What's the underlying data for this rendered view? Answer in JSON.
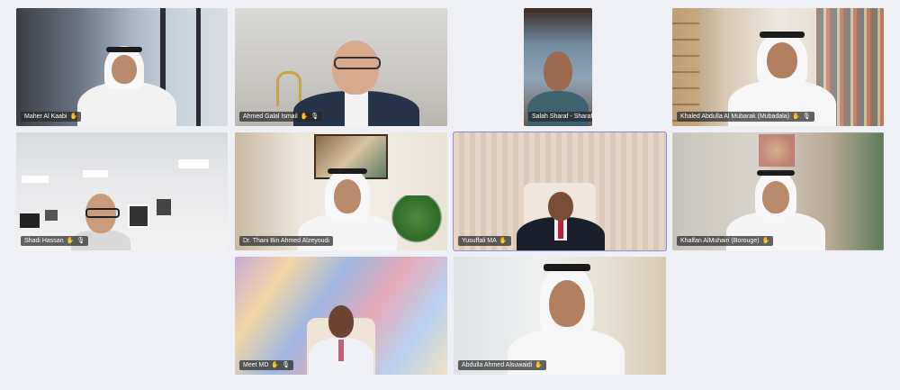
{
  "participants": [
    {
      "name": "Maher Al Kaabi",
      "mic": "muted"
    },
    {
      "name": "Ahmed Galal Ismail",
      "mic": "muted"
    },
    {
      "name": "Salah Sharaf - Sharaf Group",
      "mic": "muted"
    },
    {
      "name": "Khaled Abdulla Al Mubarak (Mubadala)",
      "mic": "muted"
    },
    {
      "name": "Shadi Hassan",
      "mic": "muted"
    },
    {
      "name": "Dr. Thani Bin Ahmed Alzeyoudi",
      "mic": "muted"
    },
    {
      "name": "Yusuffali MA",
      "mic": "muted"
    },
    {
      "name": "Khalfan AlMuhairi (Borouge)",
      "mic": "muted"
    },
    {
      "name": "Meet MD",
      "mic": "muted"
    },
    {
      "name": "Abdulla Ahmed Alsuwaidi",
      "mic": "muted"
    }
  ],
  "icons": {
    "hand": "hand-icon",
    "mic": "mic-muted-icon"
  },
  "colors": {
    "background": "#eef0f5",
    "active_border": "#8b8fd6",
    "name_tag_bg": "#282828"
  }
}
